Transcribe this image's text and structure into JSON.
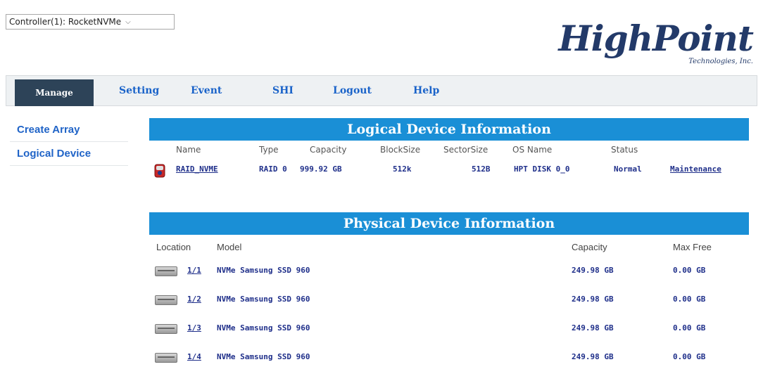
{
  "controller": {
    "selected": "Controller(1): RocketNVMe"
  },
  "logo": {
    "main": "HighPoint",
    "sub": "Technologies, Inc."
  },
  "nav": {
    "items": [
      "Manage",
      "Setting",
      "Event",
      "SHI",
      "Logout",
      "Help"
    ],
    "active": "Manage"
  },
  "sidebar": {
    "items": [
      "Create Array",
      "Logical Device"
    ]
  },
  "logical": {
    "header": "Logical Device Information",
    "columns": [
      "Name",
      "Type",
      "Capacity",
      "BlockSize",
      "SectorSize",
      "OS Name",
      "Status"
    ],
    "rows": [
      {
        "name": "RAID_NVME",
        "type": "RAID 0",
        "capacity": "999.92 GB",
        "blocksize": "512k",
        "sectorsize": "512B",
        "osname": "HPT DISK 0_0",
        "status": "Normal",
        "action": "Maintenance"
      }
    ]
  },
  "physical": {
    "header": "Physical Device Information",
    "columns": [
      "Location",
      "Model",
      "Capacity",
      "Max Free"
    ],
    "rows": [
      {
        "location": "1/1",
        "model": "NVMe Samsung SSD 960",
        "capacity": "249.98 GB",
        "maxfree": "0.00 GB"
      },
      {
        "location": "1/2",
        "model": "NVMe Samsung SSD 960",
        "capacity": "249.98 GB",
        "maxfree": "0.00 GB"
      },
      {
        "location": "1/3",
        "model": "NVMe Samsung SSD 960",
        "capacity": "249.98 GB",
        "maxfree": "0.00 GB"
      },
      {
        "location": "1/4",
        "model": "NVMe Samsung SSD 960",
        "capacity": "249.98 GB",
        "maxfree": "0.00 GB"
      }
    ]
  }
}
